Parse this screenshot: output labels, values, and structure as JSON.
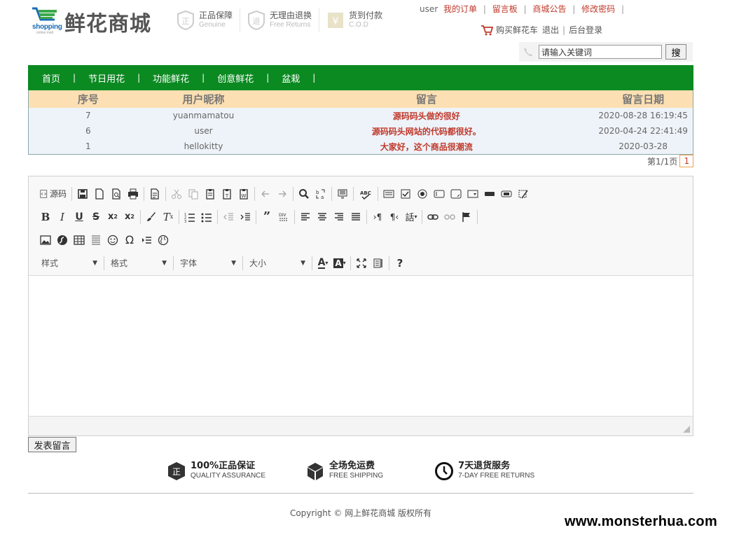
{
  "logo": {
    "name": "鲜花商城",
    "shopping": "shopping",
    "shopping_sub": "online mall"
  },
  "badges": [
    {
      "main": "正品保障",
      "sub": "Genuine",
      "icon": "genuine-shield-icon"
    },
    {
      "main": "无理由退换",
      "sub": "Free Returns",
      "icon": "returns-shield-icon"
    },
    {
      "main": "货到付款",
      "sub": "C.O.D",
      "icon": "cod-icon"
    }
  ],
  "topnav": {
    "user": "user",
    "links": [
      "我的订单",
      "留言板",
      "商城公告",
      "修改密码"
    ],
    "cart": "购买鲜花车",
    "logout": "退出",
    "admin": "后台登录"
  },
  "search": {
    "placeholder": "请输入关键词",
    "value": "请输入关键词",
    "button": "搜"
  },
  "nav": {
    "items": [
      "首页",
      "节日用花",
      "功能鲜花",
      "创意鲜花",
      "盆栽"
    ]
  },
  "table": {
    "headers": [
      "序号",
      "用户昵称",
      "留言",
      "留言日期"
    ],
    "rows": [
      {
        "id": "7",
        "user": "yuanmamatou",
        "message": "源码码头做的很好",
        "date": "2020-08-28 16:19:45"
      },
      {
        "id": "6",
        "user": "user",
        "message": "源码码头网站的代码都很好。",
        "date": "2020-04-24 22:41:49"
      },
      {
        "id": "1",
        "user": "hellokitty",
        "message": "大家好，这个商品很潮流",
        "date": "2020-03-28"
      }
    ]
  },
  "pager": {
    "label": "第1/1页",
    "current": "1"
  },
  "editor": {
    "source_label": "源码",
    "combos": [
      "样式",
      "格式",
      "字体",
      "大小"
    ]
  },
  "submit_label": "发表留言",
  "guarantees": [
    {
      "main": "100%正品保证",
      "sub": "QUALITY ASSURANCE",
      "icon": "genuine-badge-icon"
    },
    {
      "main": "全场免运费",
      "sub": "FREE SHIPPING",
      "icon": "box-icon"
    },
    {
      "main": "7天退货服务",
      "sub": "7-DAY FREE RETURNS",
      "icon": "clock-icon"
    }
  ],
  "copyright": "Copyright © 网上鲜花商城 版权所有",
  "watermark": "www.monsterhua.com",
  "colors": {
    "nav_green": "#0c8a22",
    "table_header": "#fcdfb2",
    "link_red": "#c0392b"
  }
}
